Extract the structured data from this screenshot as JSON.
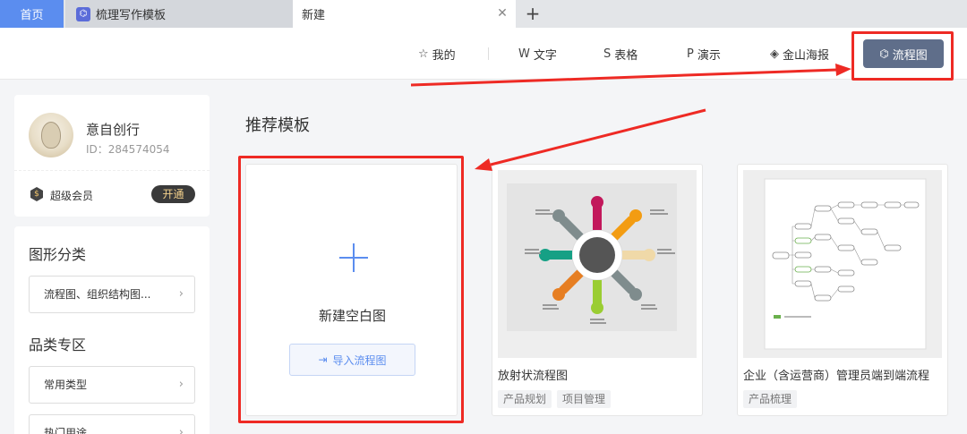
{
  "tabs": {
    "home": "首页",
    "template": "梳理写作模板",
    "new": "新建",
    "add": "+"
  },
  "toolbar": {
    "mine": "我的",
    "text": "文字",
    "sheet": "表格",
    "present": "演示",
    "poster": "金山海报",
    "flow": "流程图"
  },
  "user": {
    "name": "意自创行",
    "id": "ID：284574054",
    "vip_label": "超级会员",
    "vip_button": "开通"
  },
  "sidebar": {
    "category_title": "图形分类",
    "category_item": "流程图、组织结构图...",
    "zone_title": "品类专区",
    "zone_item_1": "常用类型",
    "zone_item_2": "热门用途"
  },
  "main": {
    "section_title": "推荐模板",
    "blank_label": "新建空白图",
    "import_label": "导入流程图",
    "templates": [
      {
        "title": "放射状流程图",
        "tags": [
          "产品规划",
          "项目管理"
        ]
      },
      {
        "title": "企业（含运营商）管理员端到端流程",
        "tags": [
          "产品梳理"
        ]
      }
    ]
  },
  "colors": {
    "accent": "#5b8def",
    "annotation_red": "#ee2a24",
    "flow_button": "#5f6e8a"
  }
}
